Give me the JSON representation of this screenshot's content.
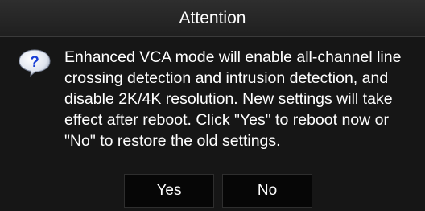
{
  "dialog": {
    "title": "Attention",
    "icon": "question-bubble-icon",
    "message": "Enhanced VCA mode will enable all-channel line crossing detection and intrusion detection, and disable 2K/4K resolution. New settings will take effect after reboot. Click \"Yes\" to reboot now or \"No\" to restore the old settings.",
    "buttons": {
      "yes_label": "Yes",
      "no_label": "No"
    }
  },
  "colors": {
    "background": "#161616",
    "titlebar": "#2a2a2a",
    "text": "#ffffff",
    "icon_blue": "#1a3fd6"
  }
}
